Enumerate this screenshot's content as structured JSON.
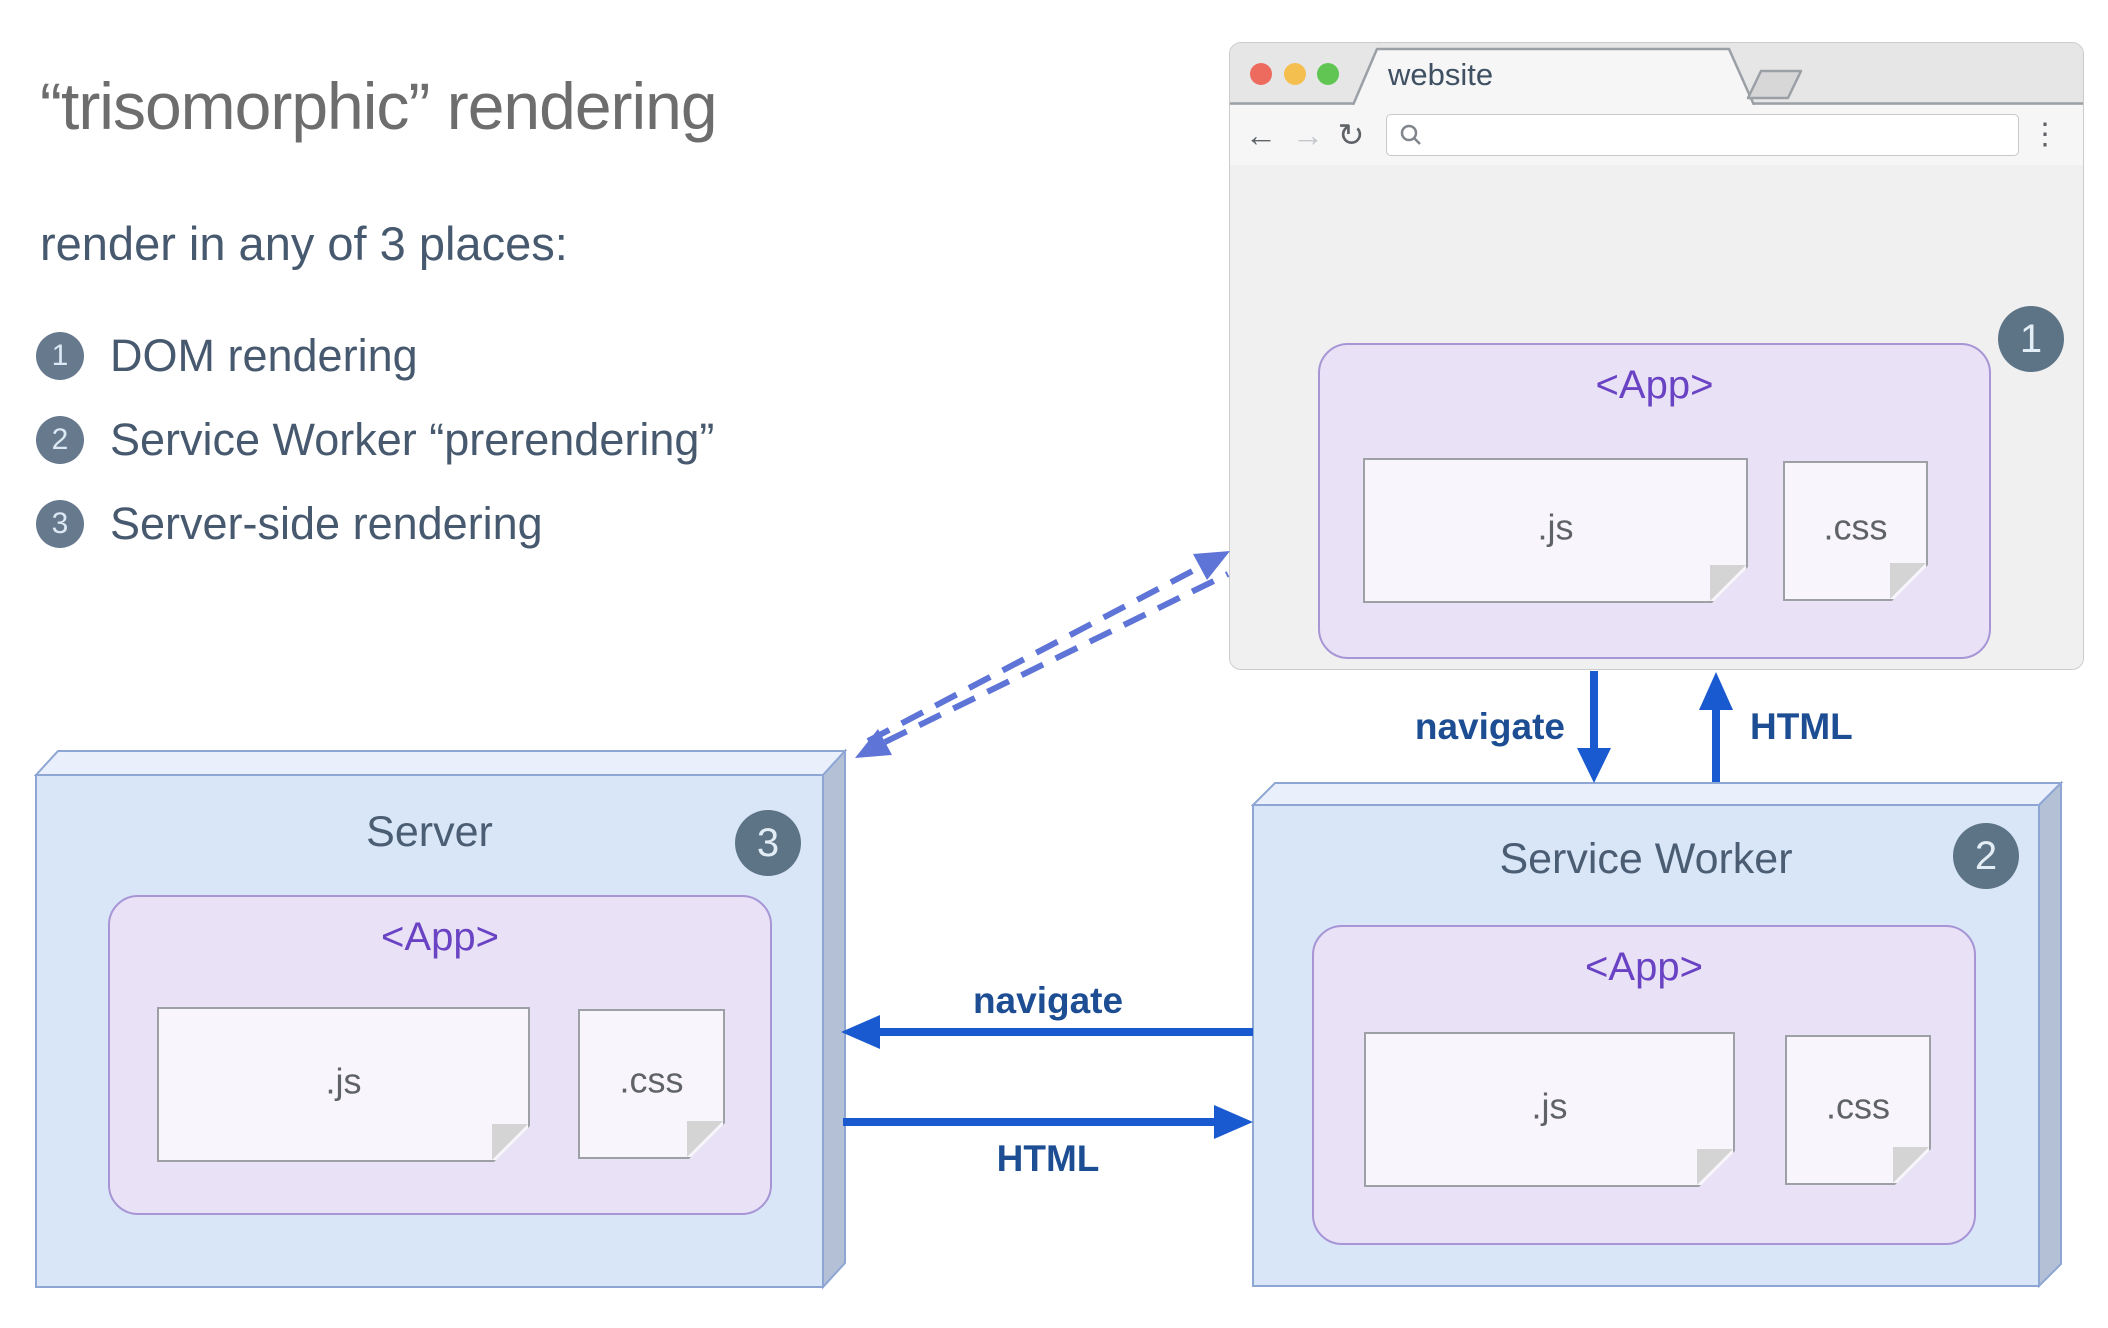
{
  "page": {
    "title": "“trisomorphic” rendering",
    "subtitle": "render in any of 3 places:"
  },
  "list": {
    "items": [
      {
        "num": "1",
        "label": "DOM rendering"
      },
      {
        "num": "2",
        "label": "Service Worker “prerendering”"
      },
      {
        "num": "3",
        "label": "Server-side rendering"
      }
    ]
  },
  "browser": {
    "tab_title": "website",
    "badge": "1",
    "url_value": "",
    "icons": {
      "back": "←",
      "forward": "→",
      "reload": "↻",
      "menu": "⋮"
    }
  },
  "nodes": {
    "server": {
      "label": "Server",
      "badge": "3"
    },
    "service_worker": {
      "label": "Service Worker",
      "badge": "2"
    }
  },
  "app": {
    "label": "<App>",
    "js_label": ".js",
    "css_label": ".css"
  },
  "arrows": {
    "navigate_down": "navigate",
    "html_up": "HTML",
    "navigate_left": "navigate",
    "html_right": "HTML"
  },
  "colors": {
    "arrow_blue": "#1a5ad1",
    "dashed_blue": "#5e74d6",
    "label_navy": "#1d4e93",
    "badge_slate": "#5d7486",
    "list_circle": "#66798d",
    "box_front": "#d9e6f8",
    "box_top": "#e9f0fc",
    "box_side": "#b4c0d6",
    "box_border": "#8ea6d3",
    "app_fill": "#e9e2f6",
    "app_border": "#a795d5",
    "app_text": "#6a43c4",
    "traffic_red": "#ed6a5e",
    "traffic_yellow": "#f4bf4f",
    "traffic_green": "#61c554"
  }
}
